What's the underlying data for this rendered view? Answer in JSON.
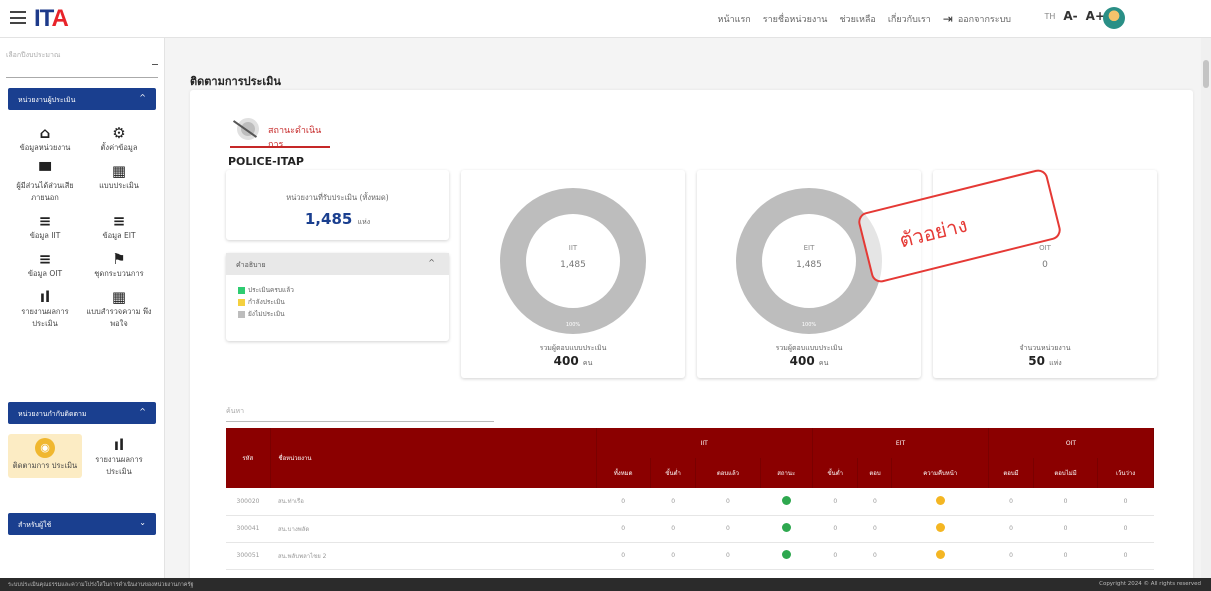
{
  "header": {
    "logo": "ITA",
    "nav": [
      "หน้าแรก",
      "รายชื่อหน่วยงาน",
      "ช่วยเหลือ",
      "เกี่ยวกับเรา"
    ],
    "logout": "ออกจากระบบ",
    "lang": "TH",
    "font_small": "A-",
    "font_large": "A+"
  },
  "sidebar": {
    "select_placeholder": "เลือกปีงบประมาณ",
    "section1": {
      "title": "หน่วยงานผู้ประเมิน",
      "items": [
        {
          "label": "ข้อมูลหน่วยงาน",
          "icon": "building-icon"
        },
        {
          "label": "ตั้งค่าข้อมูล",
          "icon": "settings-icon"
        },
        {
          "label": "ผู้มีส่วนได้ส่วนเสีย ภายนอก",
          "icon": "group-icon"
        },
        {
          "label": "แบบประเมิน",
          "icon": "qr-icon"
        },
        {
          "label": "ข้อมูล IIT",
          "icon": "list-icon"
        },
        {
          "label": "ข้อมูล EIT",
          "icon": "list-icon"
        },
        {
          "label": "ข้อมูล OIT",
          "icon": "list-icon"
        },
        {
          "label": "ชุดกระบวนการ",
          "icon": "flag-icon"
        },
        {
          "label": "รายงานผลการ ประเมิน",
          "icon": "bar-chart-icon"
        },
        {
          "label": "แบบสำรวจความ พึงพอใจ",
          "icon": "qr-icon"
        }
      ]
    },
    "section2": {
      "title": "หน่วยงานกำกับติดตาม",
      "items": [
        {
          "label": "ติดตามการ ประเมิน",
          "icon": "tracking-icon"
        },
        {
          "label": "รายงานผลการ ประเมิน",
          "icon": "bar-chart-icon"
        }
      ]
    },
    "section3": {
      "title": "สำหรับผู้ใช้"
    }
  },
  "main": {
    "page_title": "ติดตามการประเมิน",
    "status_tab": "สถานะดำเนินการ",
    "org_name": "POLICE-ITAP",
    "summary": {
      "label": "หน่วยงานที่รับประเมิน (ทั้งหมด)",
      "value": "1,485",
      "unit": "แห่ง"
    },
    "legend": {
      "title": "คำอธิบาย",
      "items": [
        {
          "label": "ประเมินครบแล้ว",
          "color": "#2ecc71"
        },
        {
          "label": "กำลังประเมิน",
          "color": "#f4d03f"
        },
        {
          "label": "ยังไม่ประเมิน",
          "color": "#bdbdbd"
        }
      ]
    },
    "donuts": [
      {
        "name": "IIT",
        "num": "1,485",
        "segment_label": "100%",
        "caption": "รวมผู้ตอบแบบประเมิน",
        "total": "400",
        "unit": "คน",
        "fill": 1.0
      },
      {
        "name": "EIT",
        "num": "1,485",
        "segment_label": "100%",
        "caption": "รวมผู้ตอบแบบประเมิน",
        "total": "400",
        "unit": "คน",
        "fill": 1.0
      },
      {
        "name": "OIT",
        "num": "0",
        "segment_label": "",
        "caption": "จำนวนหน่วยงาน",
        "total": "50",
        "unit": "แห่ง",
        "fill": 0.0
      }
    ],
    "watermark": "ตัวอย่าง",
    "search_placeholder": "ค้นหา",
    "table": {
      "groups": {
        "iit": "IIT",
        "eit": "EIT",
        "oit": "OIT"
      },
      "col_code": "รหัส",
      "col_name": "ชื่อหน่วยงาน",
      "iit_cols": [
        "ทั้งหมด",
        "ขั้นต่ำ",
        "ตอบแล้ว",
        "สถานะ"
      ],
      "eit_cols": [
        "ขั้นต่ำ",
        "ตอบ",
        "ความคืบหน้า"
      ],
      "oit_cols": [
        "ตอบมี",
        "ตอบไม่มี",
        "เว้นว่าง"
      ],
      "rows": [
        {
          "code": "300020",
          "name": "สน.ท่าเรือ",
          "vals": [
            "0",
            "0",
            "0"
          ],
          "eit": [
            "0",
            "0"
          ],
          "oit": [
            "0",
            "0",
            "0"
          ]
        },
        {
          "code": "300041",
          "name": "สน.บางพลัด",
          "vals": [
            "0",
            "0",
            "0"
          ],
          "eit": [
            "0",
            "0"
          ],
          "oit": [
            "0",
            "0",
            "0"
          ]
        },
        {
          "code": "300051",
          "name": "สน.พลับพลาไชย 2",
          "vals": [
            "0",
            "0",
            "0"
          ],
          "eit": [
            "0",
            "0"
          ],
          "oit": [
            "0",
            "0",
            "0"
          ]
        }
      ]
    }
  },
  "footer": {
    "left": "ระบบประเมินคุณธรรมและความโปร่งใสในการดำเนินงานของหน่วยงานภาครัฐ",
    "right": "Copyright 2024 © All rights reserved"
  }
}
